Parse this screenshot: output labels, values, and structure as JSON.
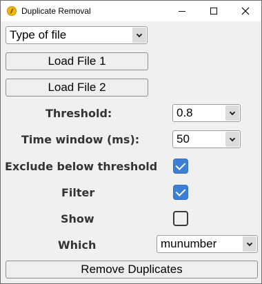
{
  "window": {
    "title": "Duplicate Removal",
    "controls": [
      "minimize",
      "maximize",
      "close"
    ]
  },
  "file_type_select": {
    "selected": "Type of file"
  },
  "buttons": {
    "load_file_1": "Load File 1",
    "load_file_2": "Load File 2",
    "remove_duplicates": "Remove Duplicates"
  },
  "threshold": {
    "label": "Threshold:",
    "value": "0.8"
  },
  "time_window": {
    "label": "Time window (ms):",
    "value": "50"
  },
  "exclude_below_threshold": {
    "label": "Exclude below threshold",
    "checked": true
  },
  "filter": {
    "label": "Filter",
    "checked": true
  },
  "show": {
    "label": "Show",
    "checked": false
  },
  "which": {
    "label": "Which",
    "value": "munumber"
  },
  "colors": {
    "checkbox_accent": "#3b7fd6",
    "background": "#f0f0f0"
  }
}
